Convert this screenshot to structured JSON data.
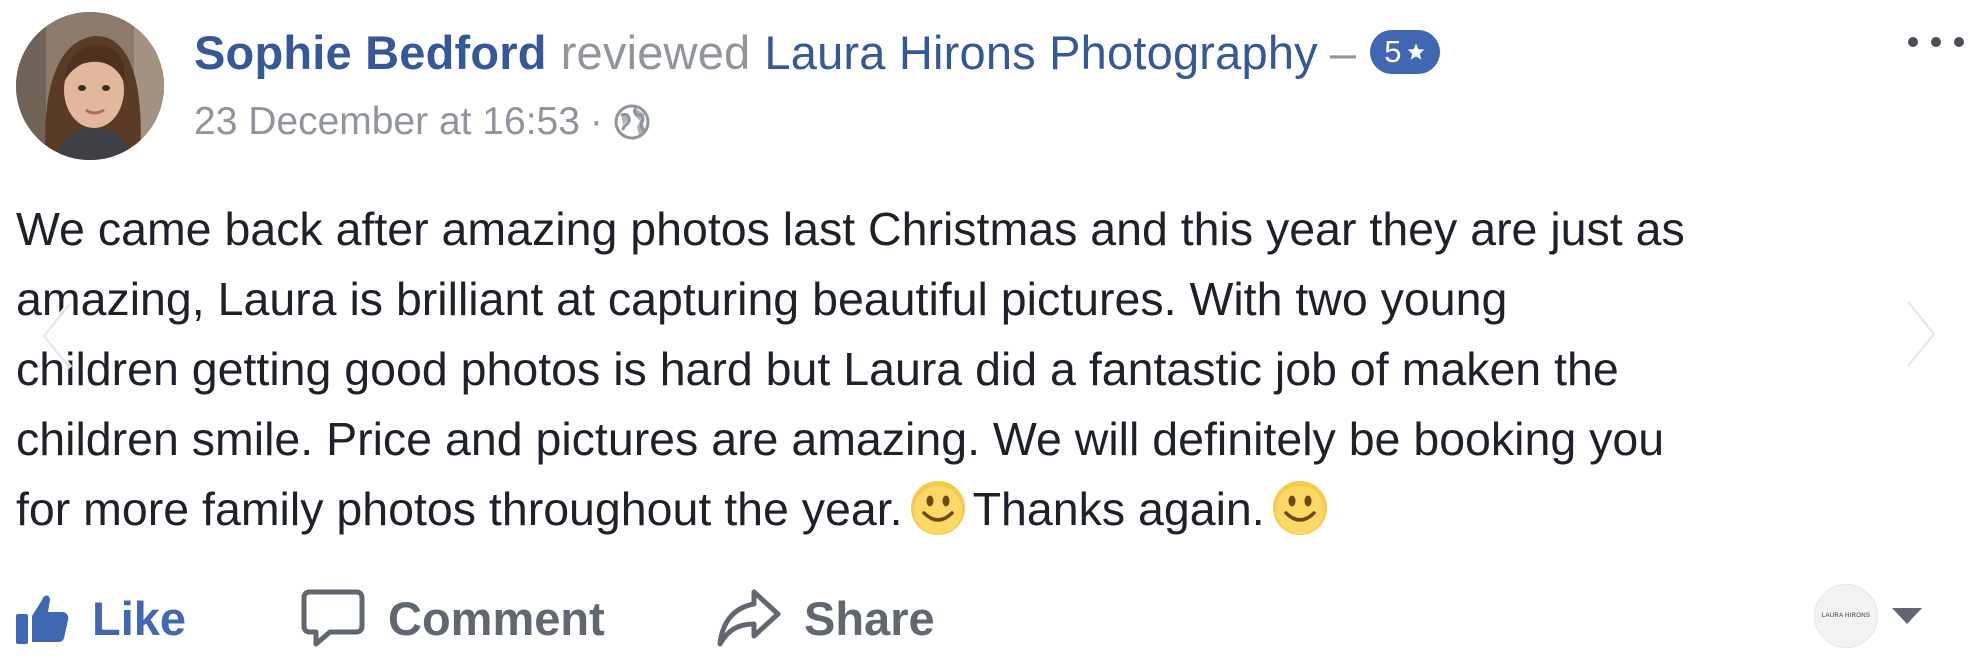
{
  "header": {
    "author_name": "Sophie Bedford",
    "action_word": "reviewed",
    "page_name": "Laura Hirons Photography",
    "separator": "–",
    "rating": "5",
    "rating_icon": "star-icon",
    "timestamp": "23 December at 16:53",
    "meta_separator": "·",
    "privacy_icon": "globe-icon"
  },
  "review": {
    "lines": [
      "We came back after amazing photos last Christmas and this year they are just as",
      "amazing, Laura is brilliant at capturing beautiful pictures. With two young",
      "children getting good photos is hard but Laura did a fantastic job of maken the",
      "children smile. Price and pictures are amazing. We will definitely be booking you",
      "for more family photos throughout the year.",
      "Thanks again."
    ]
  },
  "actions": {
    "like": "Like",
    "comment": "Comment",
    "share": "Share"
  },
  "page_selector": {
    "avatar_text": "LAURA HIRONS"
  },
  "colors": {
    "link": "#365899",
    "accent": "#4267b2",
    "muted": "#90949c",
    "text": "#1d2129",
    "action_text": "#606770"
  }
}
